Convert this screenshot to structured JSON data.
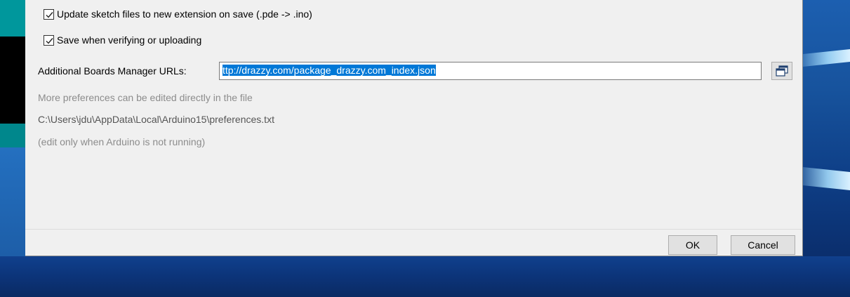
{
  "dialog": {
    "options": {
      "update_sketch_extension": {
        "label": "Update sketch files to new extension on save (.pde -> .ino)",
        "checked": true
      },
      "save_when_verifying": {
        "label": "Save when verifying or uploading",
        "checked": true
      }
    },
    "boards_manager": {
      "label": "Additional Boards Manager URLs:",
      "value": "http://drazzy.com/package_drazzy.com_index.json",
      "value_visible": "ttp://drazzy.com/package_drazzy.com_index.json",
      "edit_button_icon": "window-list-icon"
    },
    "notes": {
      "more_prefs": "More preferences can be edited directly in the file",
      "prefs_path": "C:\\Users\\jdu\\AppData\\Local\\Arduino15\\preferences.txt",
      "edit_warning": "(edit only when Arduino is not running)"
    },
    "buttons": {
      "ok": "OK",
      "cancel": "Cancel"
    }
  },
  "colors": {
    "selection": "#0078d7",
    "arduino_teal": "#00979c",
    "desktop_blue": "#17539d"
  }
}
